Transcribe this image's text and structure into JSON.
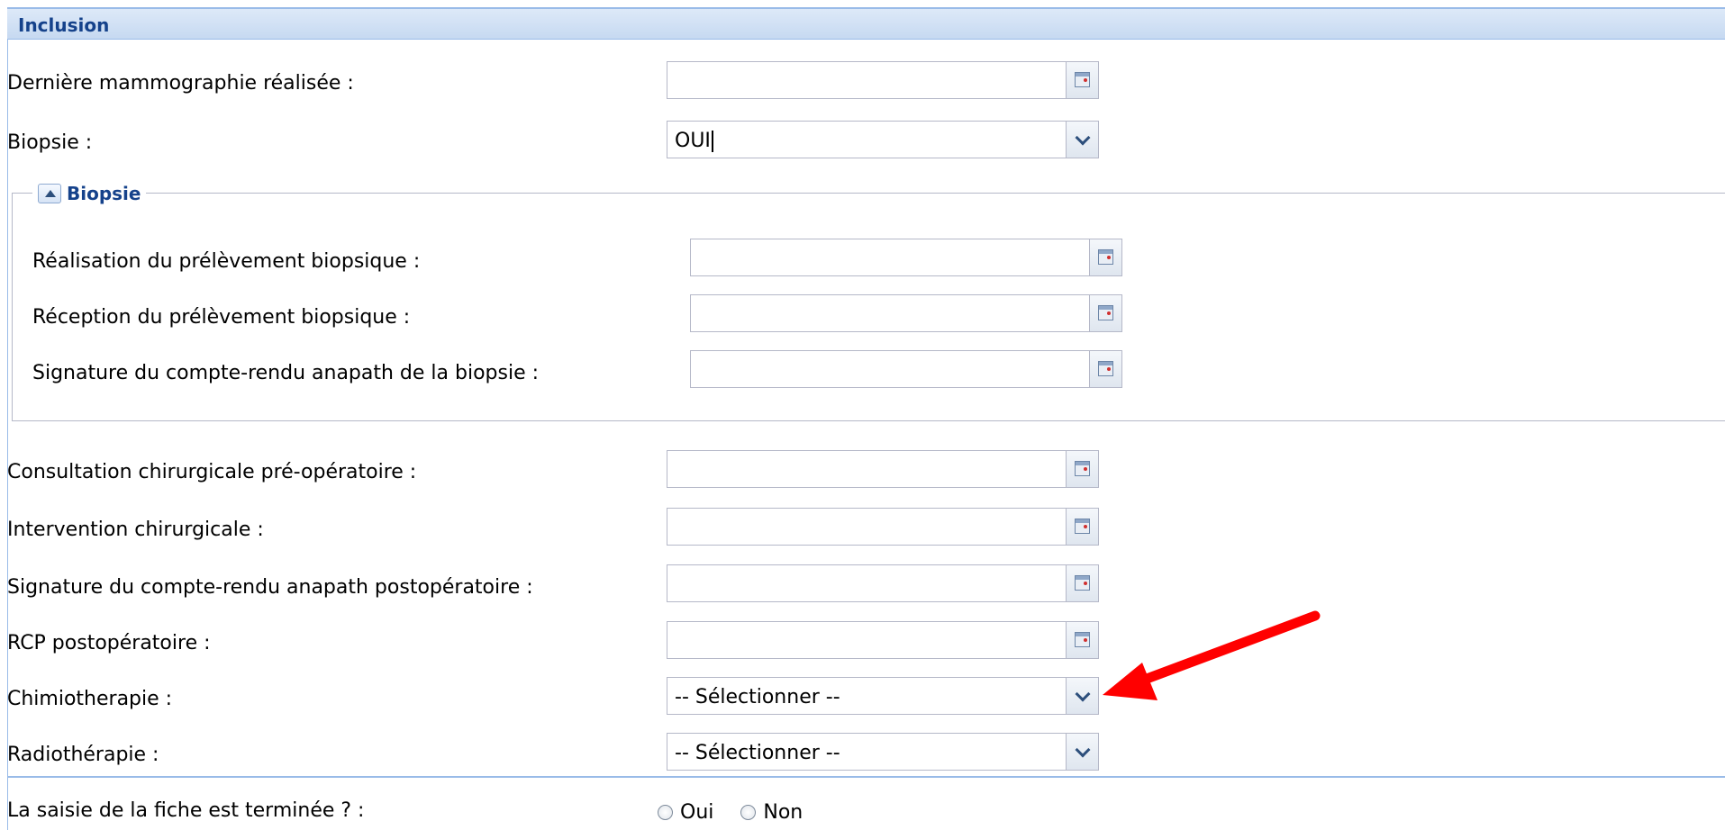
{
  "panel": {
    "title": "Inclusion"
  },
  "fields": [
    {
      "label": "Dernière mammographie réalisée :",
      "value": "",
      "icon": "calendar-icon"
    },
    {
      "label": "Biopsie :",
      "value": "OUI",
      "icon": "chevron-down-icon"
    }
  ],
  "biopsie_fieldset": {
    "legend": "Biopsie",
    "fields": [
      {
        "label": "Réalisation du prélèvement biopsique :",
        "value": "",
        "icon": "calendar-icon"
      },
      {
        "label": "Réception du prélèvement biopsique :",
        "value": "",
        "icon": "calendar-icon"
      },
      {
        "label": "Signature du compte-rendu anapath de la biopsie :",
        "value": "",
        "icon": "calendar-icon"
      }
    ]
  },
  "after_fields": [
    {
      "label": "Consultation chirurgicale pré-opératoire :",
      "value": "",
      "icon": "calendar-icon"
    },
    {
      "label": "Intervention chirurgicale :",
      "value": "",
      "icon": "calendar-icon"
    },
    {
      "label": "Signature du compte-rendu anapath postopératoire :",
      "value": "",
      "icon": "calendar-icon"
    },
    {
      "label": "RCP postopératoire :",
      "value": "",
      "icon": "calendar-icon"
    },
    {
      "label": "Chimiotherapie :",
      "value": "-- Sélectionner --",
      "icon": "chevron-down-icon"
    },
    {
      "label": "Radiothérapie :",
      "value": "-- Sélectionner --",
      "icon": "chevron-down-icon"
    }
  ],
  "completion": {
    "label": "La saisie de la fiche est terminée ? :",
    "options": [
      "Oui",
      "Non"
    ],
    "selected": null
  },
  "annotation": {
    "color": "#ff0000"
  }
}
